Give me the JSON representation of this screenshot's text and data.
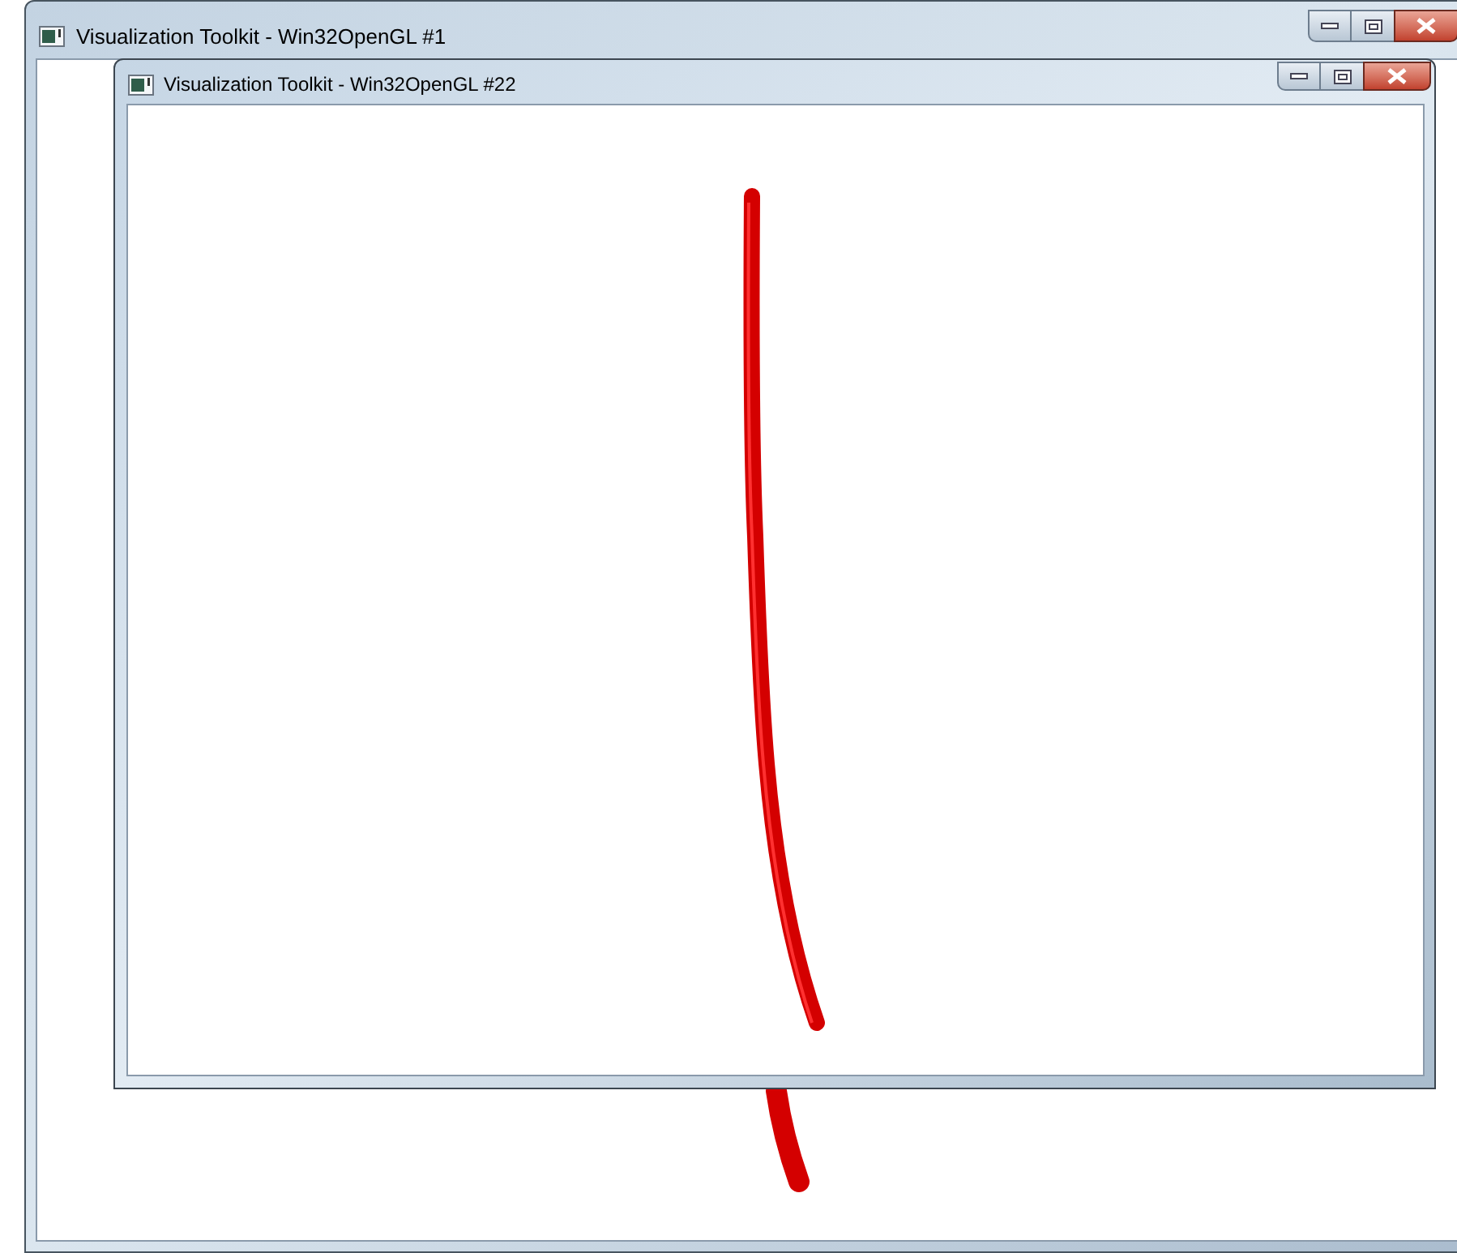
{
  "windows": [
    {
      "title": "Visualization Toolkit - Win32OpenGL #1"
    },
    {
      "title": "Visualization Toolkit - Win32OpenGL #22"
    }
  ]
}
